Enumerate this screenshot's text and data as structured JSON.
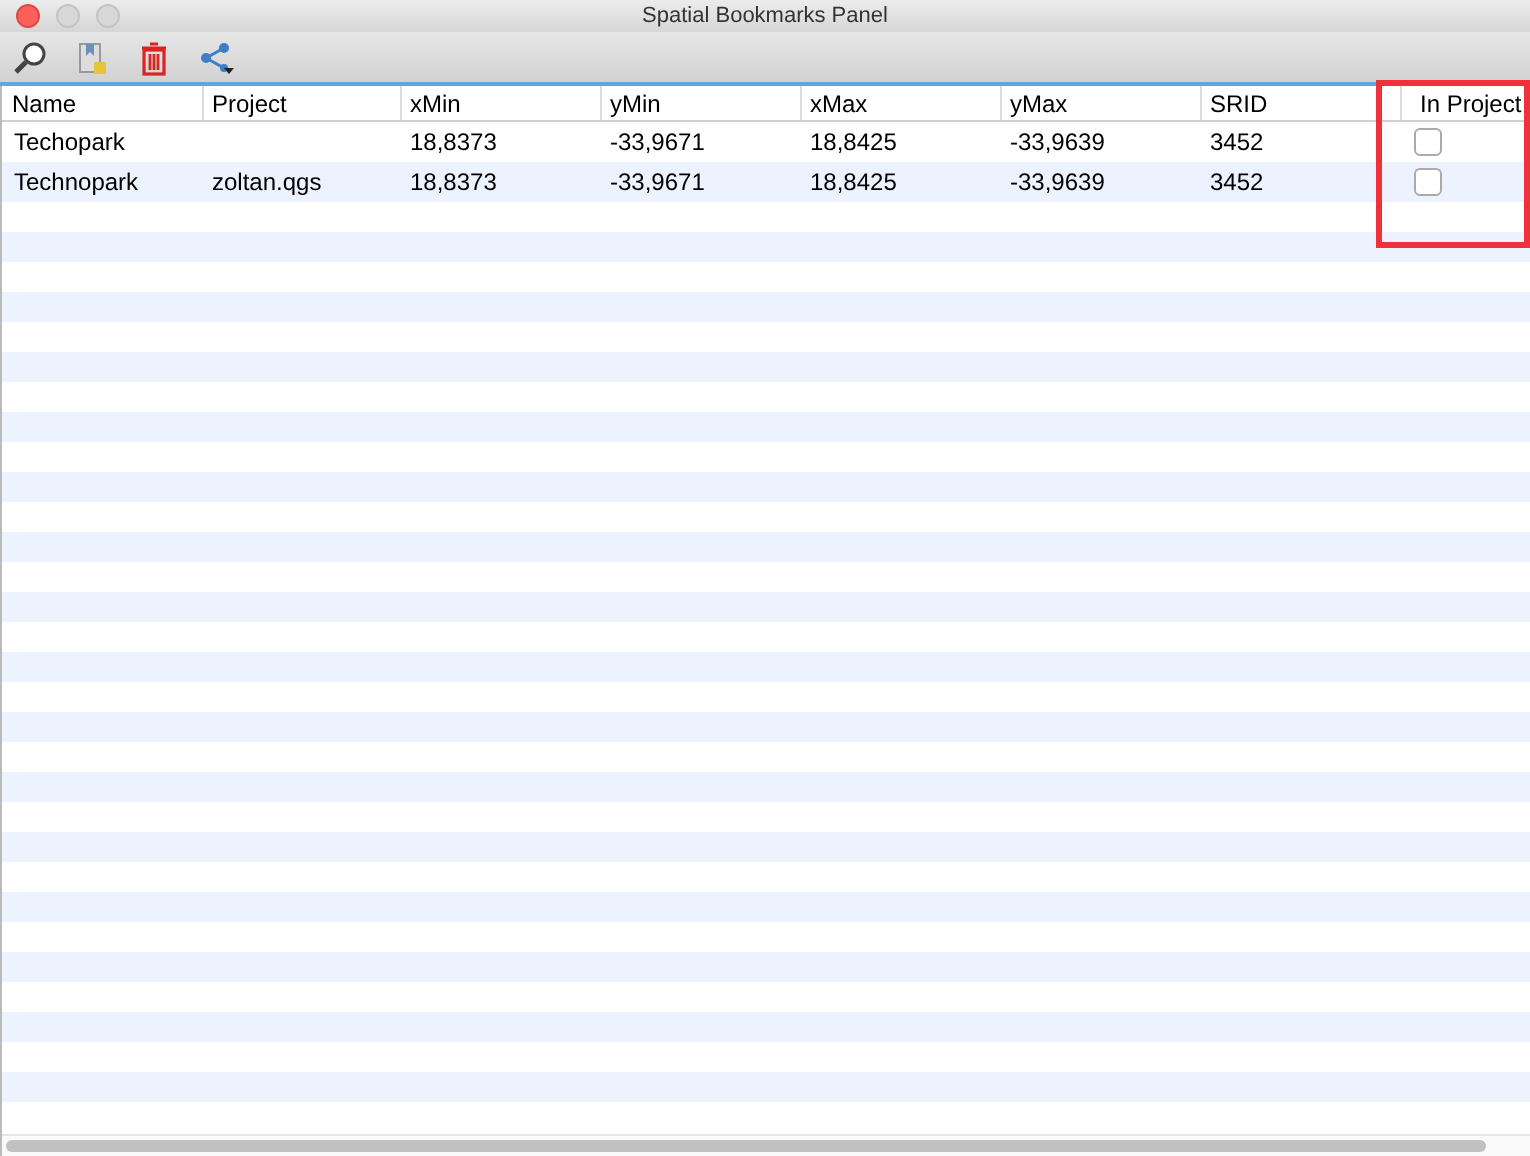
{
  "window": {
    "title": "Spatial Bookmarks Panel"
  },
  "table": {
    "columns": [
      "Name",
      "Project",
      "xMin",
      "yMin",
      "xMax",
      "yMax",
      "SRID",
      "In Project"
    ],
    "rows": [
      {
        "cells": [
          "Techopark",
          "",
          "18,8373",
          "-33,9671",
          "18,8425",
          "-33,9639",
          "3452"
        ],
        "in_project": {
          "checked": false
        }
      },
      {
        "cells": [
          "Technopark",
          "zoltan.qgs",
          "18,8373",
          "-33,9671",
          "18,8425",
          "-33,9639",
          "3452"
        ],
        "in_project": {
          "checked": false
        }
      }
    ]
  }
}
